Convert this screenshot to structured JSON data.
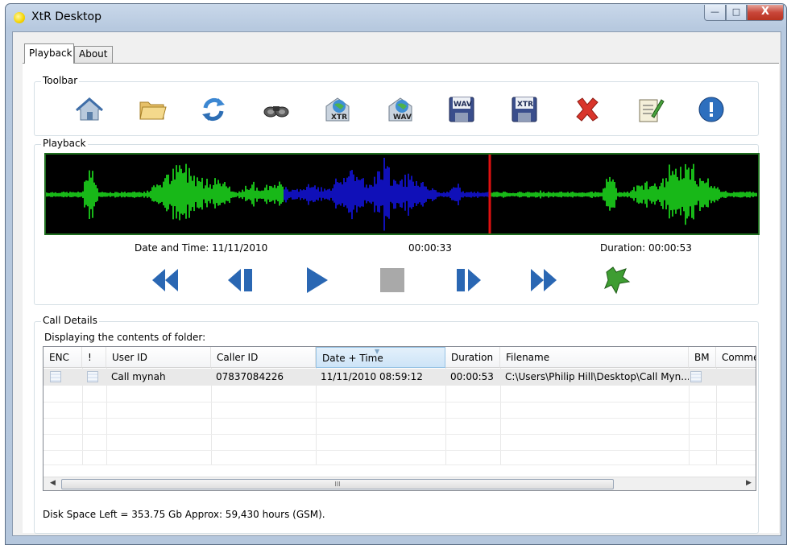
{
  "window": {
    "title": "XtR Desktop",
    "min": "—",
    "max": "□",
    "close": "X"
  },
  "tabs": [
    {
      "label": "Playback"
    },
    {
      "label": "About"
    }
  ],
  "toolbar": {
    "label": "Toolbar",
    "buttons": [
      {
        "icon": "home-icon"
      },
      {
        "icon": "folder-icon"
      },
      {
        "icon": "refresh-icon"
      },
      {
        "icon": "binoculars-icon"
      },
      {
        "icon": "export-xtr-icon",
        "text": "XTR"
      },
      {
        "icon": "export-wav-icon",
        "text": "WAV"
      },
      {
        "icon": "save-wav-icon",
        "text": "WAV"
      },
      {
        "icon": "save-xtr-icon",
        "text": "XTR"
      },
      {
        "icon": "delete-icon"
      },
      {
        "icon": "notes-icon"
      },
      {
        "icon": "info-icon"
      }
    ]
  },
  "playback": {
    "label": "Playback",
    "date_time": "Date and Time:  11/11/2010",
    "position": "00:00:33",
    "duration": "Duration:  00:00:53",
    "progress_fraction": 0.623,
    "controls": [
      "rewind-icon",
      "step-back-icon",
      "play-icon",
      "stop-icon",
      "step-forward-icon",
      "fast-forward-icon",
      "bookmark-icon"
    ]
  },
  "call_details": {
    "label": "Call Details",
    "folder_text": "Displaying the contents of folder:",
    "columns": [
      "ENC",
      "!",
      "User ID",
      "Caller ID",
      "Date + Time",
      "Duration",
      "Filename",
      "BM",
      "Commer"
    ],
    "rows": [
      {
        "user_id": "Call mynah",
        "caller_id": "07837084226",
        "date_time": "11/11/2010 08:59:12",
        "duration": "00:00:53",
        "filename": "C:\\Users\\Philip Hill\\Desktop\\Call Myn..."
      }
    ],
    "scroll_grip": "III"
  },
  "status": {
    "disk_space": "Disk Space Left = 353.75 Gb  Approx: 59,430 hours (GSM)."
  },
  "colors": {
    "wave_played": "#1414e6",
    "wave_unplayed": "#1ee61e",
    "cursor": "#e01010",
    "wave_bg": "#000000",
    "accent": "#2163b0"
  }
}
